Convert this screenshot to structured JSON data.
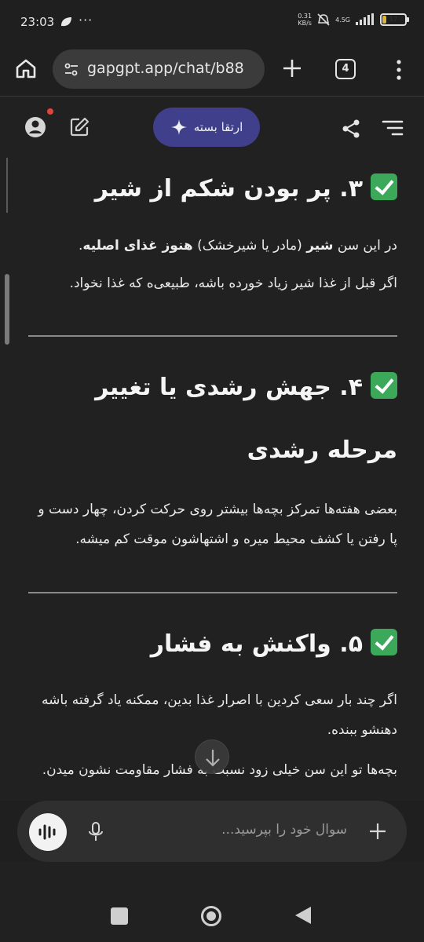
{
  "status_bar": {
    "time": "23:03",
    "dots": "···",
    "speed_value": "0.31",
    "speed_unit": "KB/s",
    "network": "4.5G",
    "battery_level": "17",
    "battery_fraction": 0.17
  },
  "browser": {
    "url": "gapgpt.app/chat/b88",
    "tab_count": "4"
  },
  "chat_header": {
    "upgrade_label": "ارتقا بسته"
  },
  "sections": [
    {
      "heading_number": "۳.",
      "heading_text": "پر بودن شکم از شیر",
      "paragraphs": [
        {
          "pre": "در این سن ",
          "bold1": "شیر",
          "mid": " (مادر یا شیرخشک) ",
          "bold2": "هنوز غذای اصلیه",
          "post": "."
        },
        {
          "text": "اگر قبل از غذا شیر زیاد خورده باشه، طبیعی‌ه که غذا نخواد."
        }
      ]
    },
    {
      "heading_number": "۴.",
      "heading_text": "جهش رشدی یا تغییر مرحله رشدی",
      "paragraphs": [
        {
          "text": "بعضی هفته‌ها تمرکز بچه‌ها بیشتر روی حرکت کردن، چهار دست و پا رفتن یا کشف محیط میره و اشتهاشون موقت کم میشه."
        }
      ]
    },
    {
      "heading_number": "۵.",
      "heading_text": "واکنش به فشار",
      "paragraphs": [
        {
          "text": "اگر چند بار سعی کردین با اصرار غذا بدین، ممکنه یاد گرفته باشه دهنشو ببنده."
        },
        {
          "text": "بچه‌ها تو این سن خیلی زود نسبت به فشار مقاومت نشون میدن."
        }
      ]
    }
  ],
  "composer": {
    "placeholder": "سوال خود را بپرسید..."
  },
  "icons": {
    "home": "home-icon",
    "tune": "tune-icon",
    "plus": "plus-icon",
    "tabs": "tabs-icon",
    "menu": "more-vert-icon",
    "profile": "account-circle-icon",
    "edit": "edit-icon",
    "sparkle": "sparkle-icon",
    "share": "share-icon",
    "hamburger": "menu-icon",
    "scroll_down": "arrow-down-icon",
    "voice": "voice-wave-icon",
    "mic": "mic-icon",
    "add": "plus-icon"
  },
  "colors": {
    "background": "#212121",
    "upgrade_button": "#3f3f8c",
    "check": "#3ba85a",
    "notification_dot": "#e0433b"
  }
}
